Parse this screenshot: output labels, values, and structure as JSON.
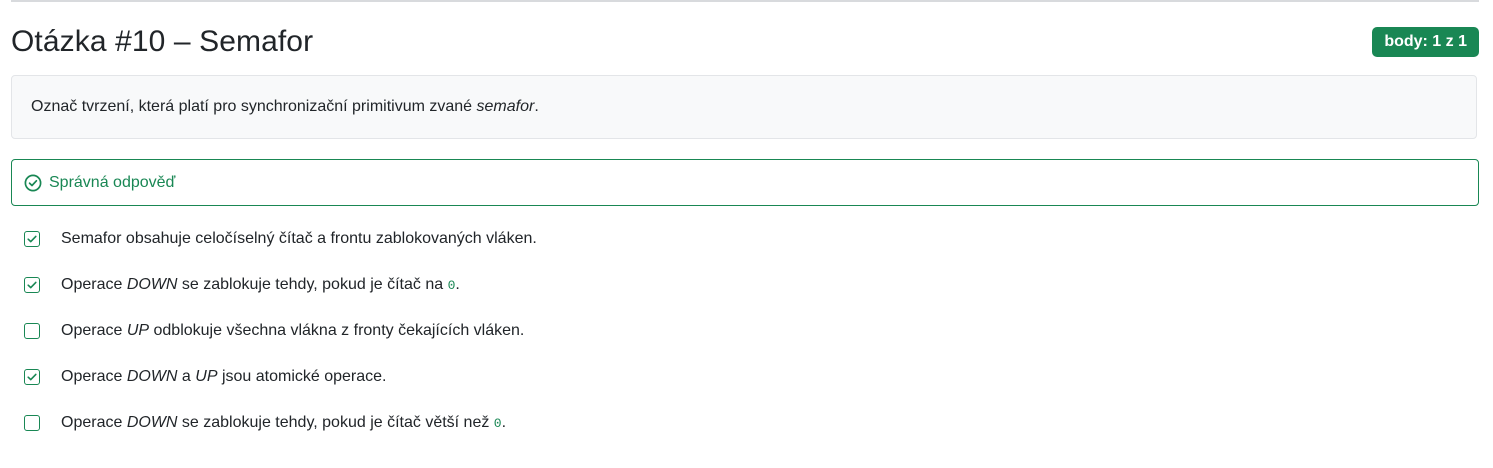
{
  "question": {
    "title": "Otázka #10 – Semafor",
    "score_badge": "body: 1 z 1",
    "prompt": {
      "before": "Označ tvrzení, která platí pro synchronizační primitivum zvané ",
      "emphasis": "semafor",
      "after": "."
    }
  },
  "feedback": {
    "icon": "check-circle-icon",
    "text": "Správná odpověď",
    "color": "#198754"
  },
  "options": [
    {
      "checked": true,
      "parts": [
        {
          "type": "text",
          "text": "Semafor obsahuje celočíselný čítač a frontu zablokovaných vláken."
        }
      ]
    },
    {
      "checked": true,
      "parts": [
        {
          "type": "text",
          "text": "Operace "
        },
        {
          "type": "em",
          "text": "DOWN"
        },
        {
          "type": "text",
          "text": " se zablokuje tehdy, pokud je čítač na "
        },
        {
          "type": "code",
          "text": "0"
        },
        {
          "type": "text",
          "text": "."
        }
      ]
    },
    {
      "checked": false,
      "parts": [
        {
          "type": "text",
          "text": "Operace "
        },
        {
          "type": "em",
          "text": "UP"
        },
        {
          "type": "text",
          "text": " odblokuje všechna vlákna z fronty čekajících vláken."
        }
      ]
    },
    {
      "checked": true,
      "parts": [
        {
          "type": "text",
          "text": "Operace "
        },
        {
          "type": "em",
          "text": "DOWN"
        },
        {
          "type": "text",
          "text": " a "
        },
        {
          "type": "em",
          "text": "UP"
        },
        {
          "type": "text",
          "text": " jsou atomické operace."
        }
      ]
    },
    {
      "checked": false,
      "parts": [
        {
          "type": "text",
          "text": "Operace "
        },
        {
          "type": "em",
          "text": "DOWN"
        },
        {
          "type": "text",
          "text": " se zablokuje tehdy, pokud je čítač větší než "
        },
        {
          "type": "code",
          "text": "0"
        },
        {
          "type": "text",
          "text": "."
        }
      ]
    }
  ],
  "colors": {
    "success": "#198754",
    "prompt_background": "#f8f9fa",
    "text": "#212529"
  }
}
